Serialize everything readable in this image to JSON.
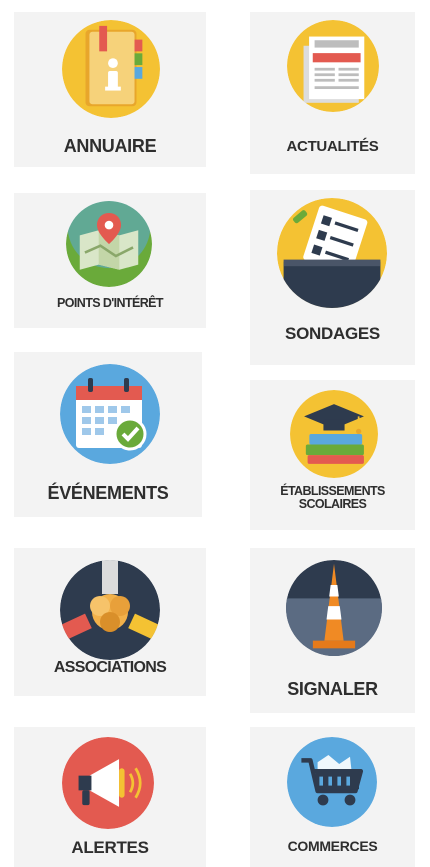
{
  "tiles": {
    "annuaire": {
      "label": "ANNUAIRE",
      "icon": "directory-book-icon"
    },
    "actualites": {
      "label": "ACTUALITÉS",
      "icon": "newspaper-icon"
    },
    "points": {
      "label": "POINTS D'INTÉRÊT",
      "icon": "map-pin-icon"
    },
    "sondages": {
      "label": "SONDAGES",
      "icon": "ballot-box-icon"
    },
    "evenements": {
      "label": "ÉVÉNEMENTS",
      "icon": "calendar-check-icon"
    },
    "etablissements": {
      "label_line1": "ÉTABLISSEMENTS",
      "label_line2": "SCOLAIRES",
      "icon": "graduation-books-icon"
    },
    "associations": {
      "label": "ASSOCIATIONS",
      "icon": "joined-hands-icon"
    },
    "signaler": {
      "label": "SIGNALER",
      "icon": "traffic-cone-icon"
    },
    "alertes": {
      "label": "ALERTES",
      "icon": "megaphone-icon"
    },
    "commerces": {
      "label": "COMMERCES",
      "icon": "shopping-cart-icon"
    }
  },
  "colors": {
    "tile_bg": "#f3f3f3",
    "label_text": "#2e2e2e",
    "yellow": "#f4c233",
    "red": "#e35a50",
    "blue": "#5aa8de",
    "navy": "#2e3b4e",
    "green": "#6aaa3a"
  }
}
